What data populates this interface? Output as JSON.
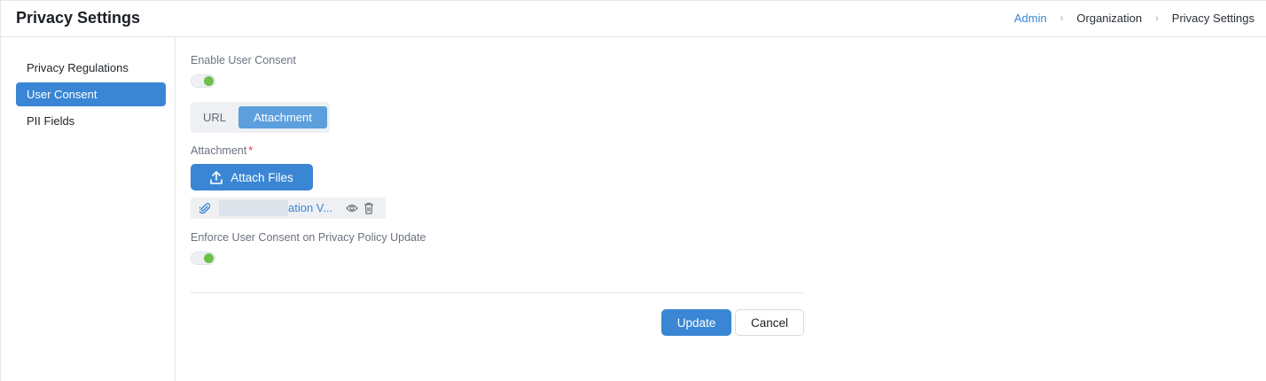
{
  "header": {
    "title": "Privacy Settings",
    "breadcrumb": [
      "Admin",
      "Organization",
      "Privacy Settings"
    ],
    "separator": "›"
  },
  "sidebar": {
    "items": [
      {
        "label": "Privacy Regulations",
        "active": false
      },
      {
        "label": "User Consent",
        "active": true
      },
      {
        "label": "PII Fields",
        "active": false
      }
    ]
  },
  "form": {
    "enable_consent_label": "Enable User Consent",
    "enable_consent_on": true,
    "source_tabs": [
      "URL",
      "Attachment"
    ],
    "selected_tab": "Attachment",
    "attachment_label": "Attachment",
    "required_mark": "*",
    "attach_button_label": "Attach Files",
    "attached_file": "ation V...",
    "enforce_label": "Enforce User Consent on Privacy Policy Update",
    "enforce_on": true
  },
  "footer": {
    "update_label": "Update",
    "cancel_label": "Cancel"
  },
  "colors": {
    "accent": "#3a86d4",
    "toggle_on": "#6cc04a",
    "required": "#e03a3a"
  },
  "icons": [
    "upload-icon",
    "paperclip-icon",
    "eye-icon",
    "trash-icon",
    "chevron-right-icon"
  ]
}
